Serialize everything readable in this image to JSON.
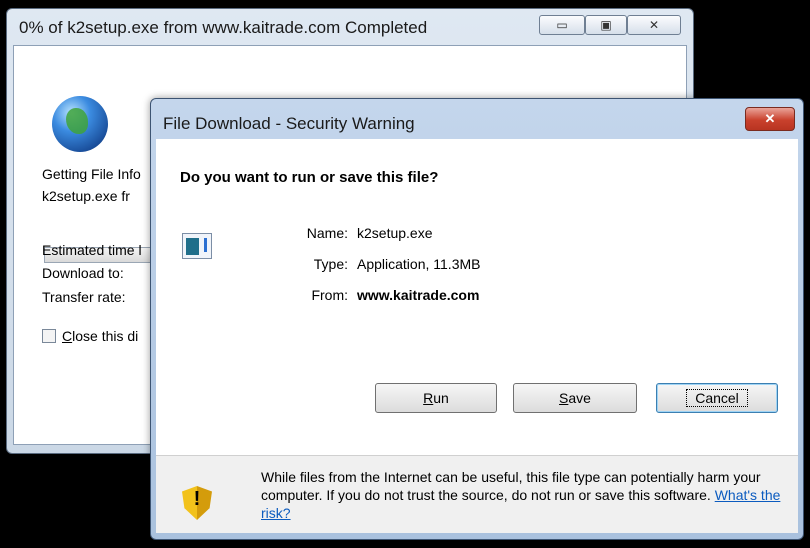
{
  "back_window": {
    "title": "0% of k2setup.exe from www.kaitrade.com Completed",
    "controls": {
      "minimize": "▭",
      "maximize": "▣",
      "close": "✕"
    },
    "getting_file_info": "Getting File Info",
    "file_line": "k2setup.exe fr",
    "estimated_time": "Estimated time l",
    "download_to": "Download to:",
    "transfer_rate": "Transfer rate:",
    "close_checkbox_label": "Close this di",
    "close_checkbox_mnemonic": "C",
    "progress_fraction": 0
  },
  "dialog": {
    "title": "File Download - Security Warning",
    "close_glyph": "✕",
    "question": "Do you want to run or save this file?",
    "name_label": "Name:",
    "name_value": "k2setup.exe",
    "type_label": "Type:",
    "type_value": "Application, 11.3MB",
    "from_label": "From:",
    "from_value": "www.kaitrade.com",
    "buttons": {
      "run_mnemonic": "R",
      "run_rest": "un",
      "save_mnemonic": "S",
      "save_rest": "ave",
      "cancel": "Cancel"
    },
    "warning_text": "While files from the Internet can be useful, this file type can potentially harm your computer. If you do not trust the source, do not run or save this software.",
    "risk_link": "What's the risk?",
    "warning_icon_glyph": "!"
  },
  "icons": {
    "globe": "globe-icon",
    "file": "application-file-icon",
    "shield": "shield-warning-icon"
  },
  "colors": {
    "link": "#0b5bbf",
    "close_button": "#c9412d",
    "title_bar": "#b9cde6"
  }
}
